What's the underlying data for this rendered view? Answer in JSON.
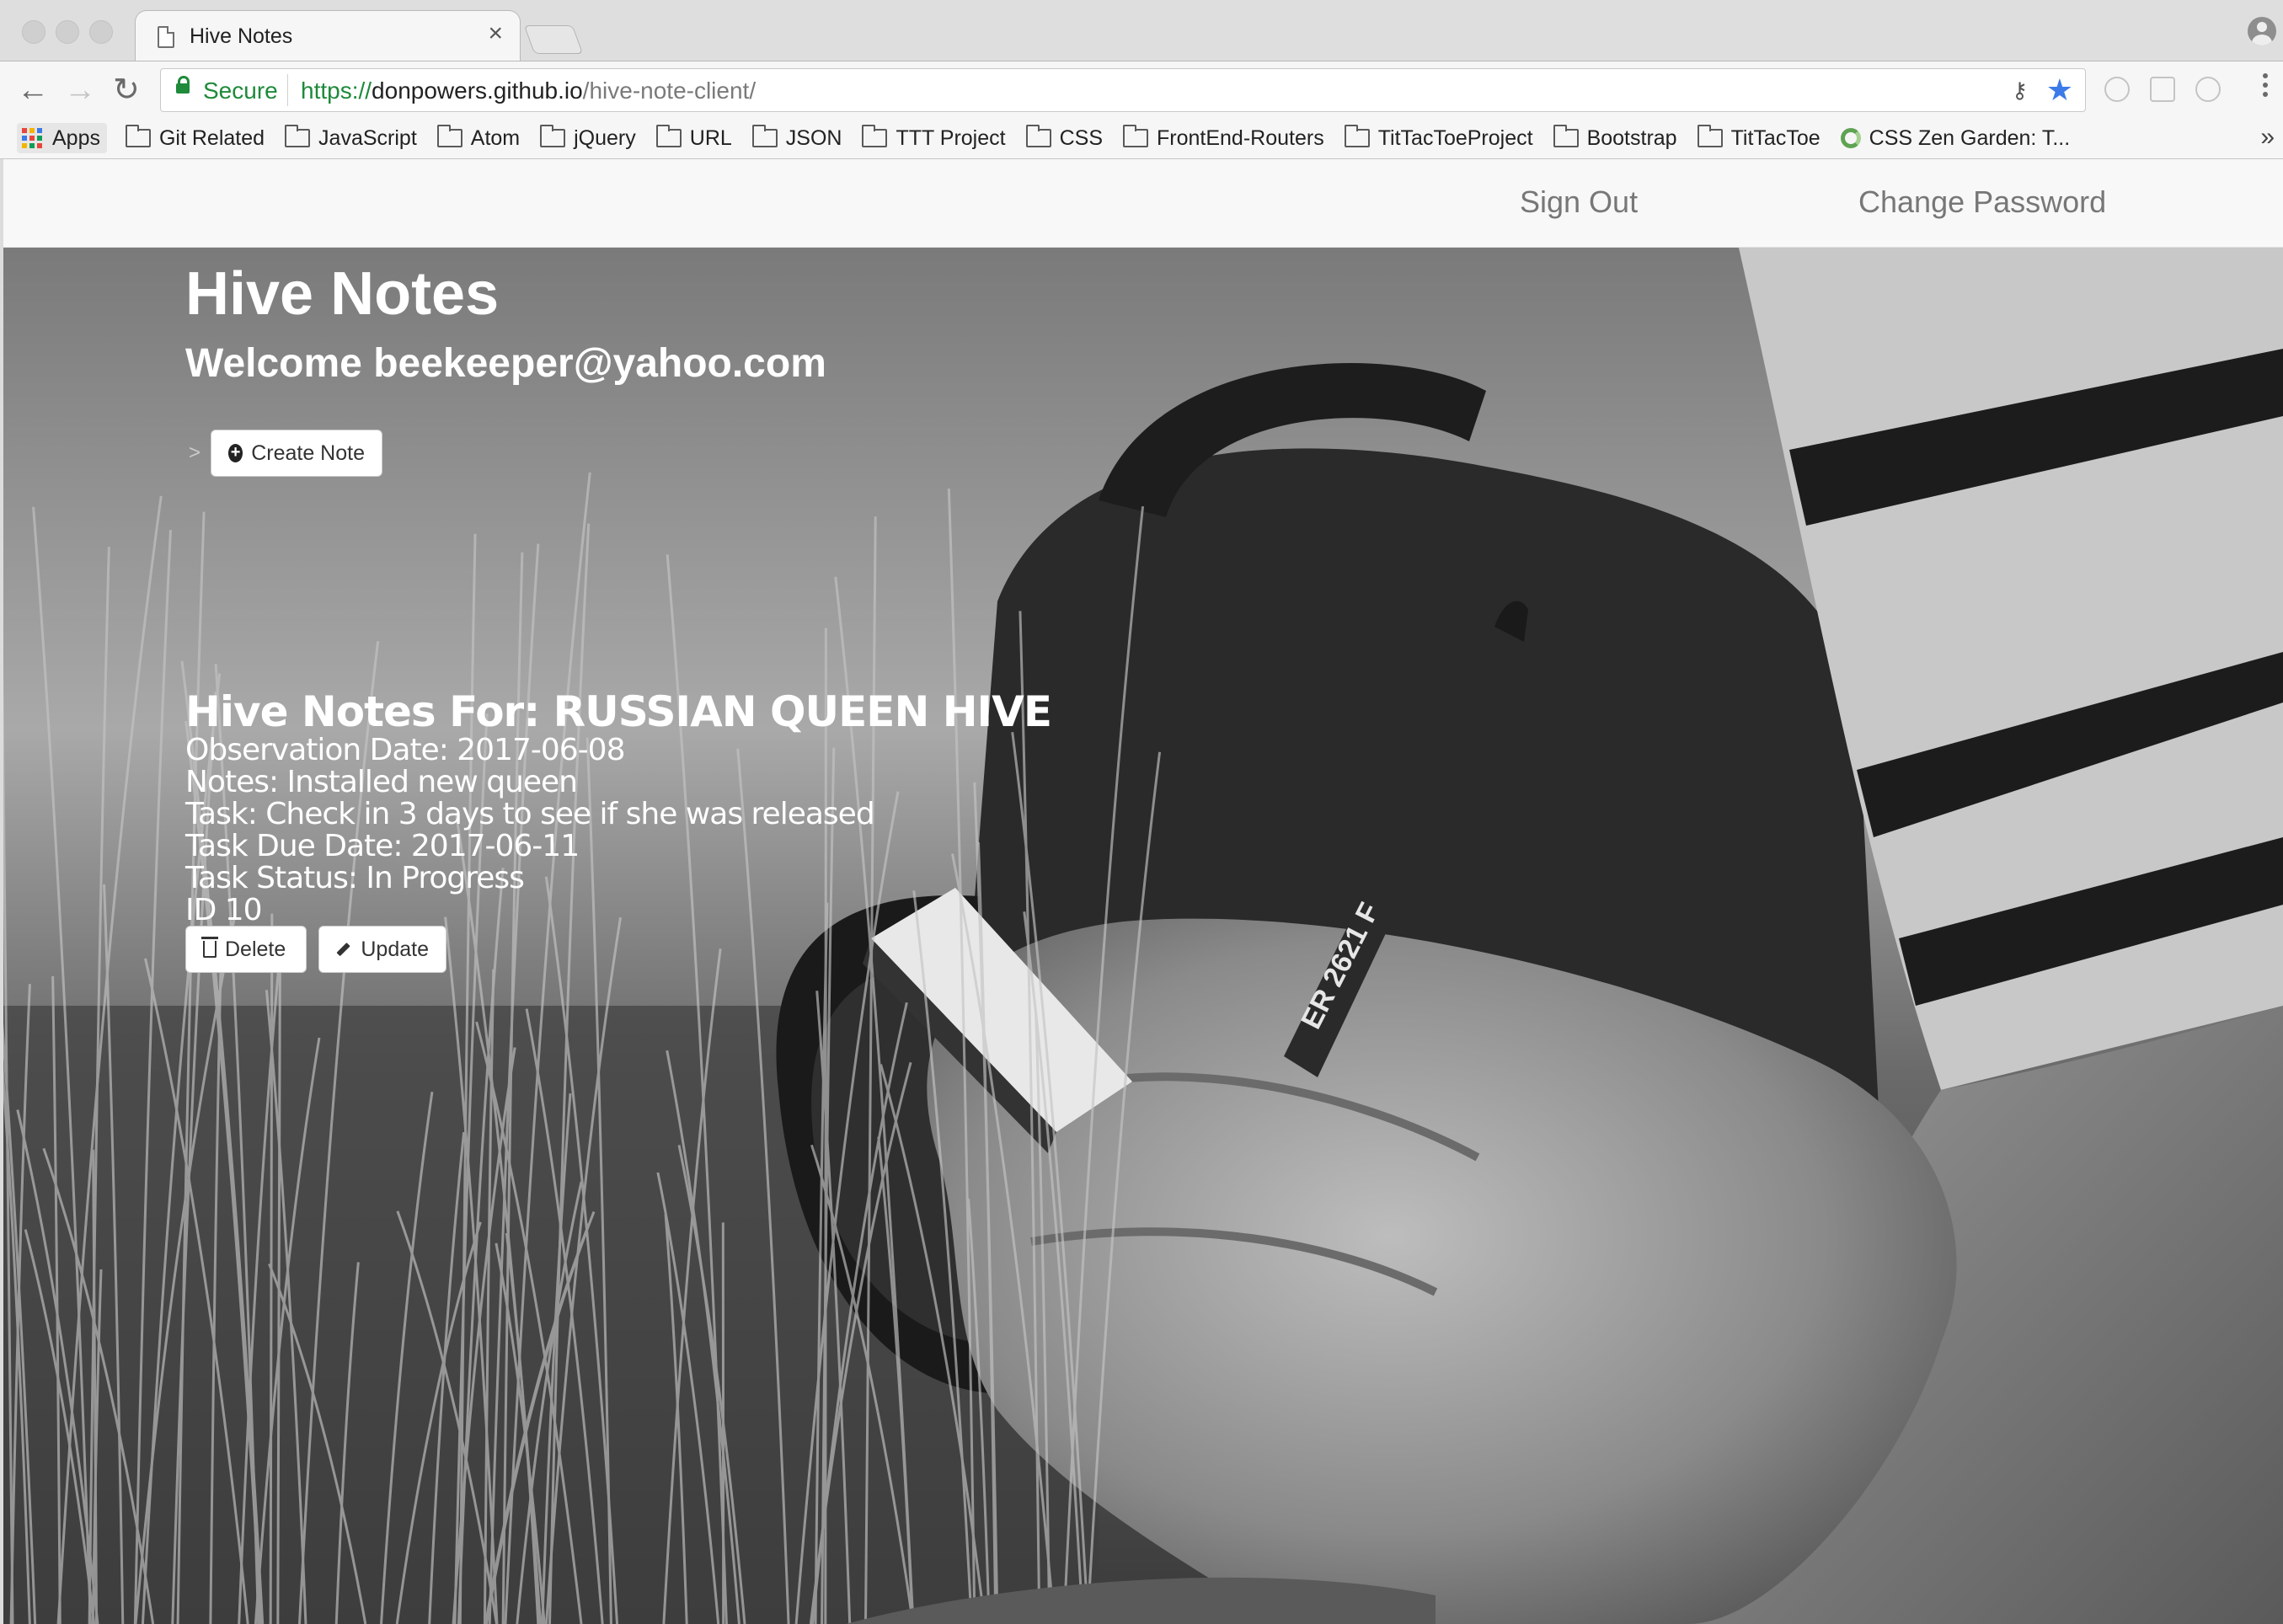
{
  "browser": {
    "tab_title": "Hive Notes",
    "tab_close": "×",
    "nav": {
      "back": "←",
      "forward": "→",
      "reload": "↻"
    },
    "address": {
      "security_label": "Secure",
      "scheme": "https://",
      "host": "donpowers.github.io",
      "path": "/hive-note-client/"
    },
    "bookmarks": {
      "apps_label": "Apps",
      "apps_grid_colors": [
        "#e8453c",
        "#f4b400",
        "#3b7ae8",
        "#3b7ae8",
        "#e8453c",
        "#0f9d58",
        "#f4b400",
        "#0f9d58",
        "#e8453c"
      ],
      "folders": [
        "Git Related",
        "JavaScript",
        "Atom",
        "jQuery",
        "URL",
        "JSON",
        "TTT Project",
        "CSS",
        "FrontEnd-Routers",
        "TitTacToeProject",
        "Bootstrap",
        "TitTacToe"
      ],
      "link": "CSS Zen Garden: T...",
      "more": "»"
    }
  },
  "navbar": {
    "sign_out": "Sign Out",
    "change_password": "Change Password"
  },
  "main": {
    "title": "Hive Notes",
    "welcome": "Welcome beekeeper@yahoo.com",
    "arrow": ">",
    "create_note": "Create Note",
    "note": {
      "heading": "Hive Notes For: RUSSIAN QUEEN HIVE",
      "observation_date": "Observation Date: 2017-06-08",
      "notes": "Notes: Installed new queen",
      "task": "Task: Check in 3 days to see if she was released",
      "task_due_date": "Task Due Date: 2017-06-11",
      "task_status": "Task Status: In Progress",
      "id": "ID 10",
      "delete_label": "Delete",
      "update_label": "Update"
    }
  },
  "hero": {
    "pencil_text": "ER 2621 F"
  }
}
